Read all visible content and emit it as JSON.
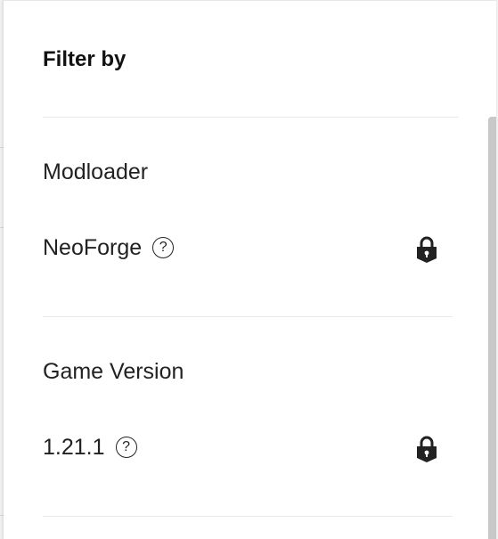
{
  "panel": {
    "title": "Filter by"
  },
  "sections": [
    {
      "title": "Modloader",
      "value": "NeoForge",
      "help_glyph": "?",
      "locked": true
    },
    {
      "title": "Game Version",
      "value": "1.21.1",
      "help_glyph": "?",
      "locked": true
    }
  ],
  "icons": {
    "help": "question-circle-icon",
    "lock": "lock-icon"
  },
  "colors": {
    "text": "#222222",
    "divider": "#e9e9e9",
    "scrollbar": "#c8c8c8"
  }
}
